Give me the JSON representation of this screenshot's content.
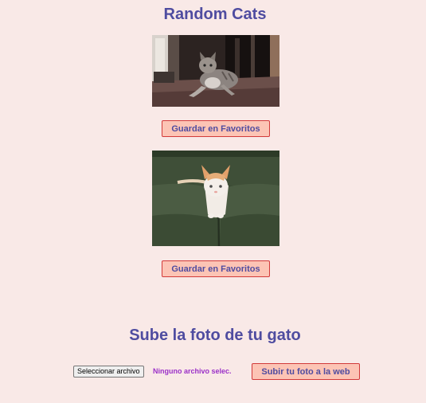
{
  "page": {
    "title": "Random Cats"
  },
  "gallery": {
    "cats": [
      {
        "favorite_label": "Guardar en Favoritos"
      },
      {
        "favorite_label": "Guardar en Favoritos"
      }
    ]
  },
  "upload": {
    "heading": "Sube la foto de tu gato",
    "choose_file_label": "Seleccionar archivo",
    "file_status": "Ninguno archivo selec.",
    "submit_label": "Subir tu foto a la web"
  },
  "colors": {
    "background": "#f9e9e7",
    "heading": "#4f4ca0",
    "button_fill": "#fcc4b5",
    "button_border": "#d23a3a",
    "file_status": "#9b30c8"
  }
}
